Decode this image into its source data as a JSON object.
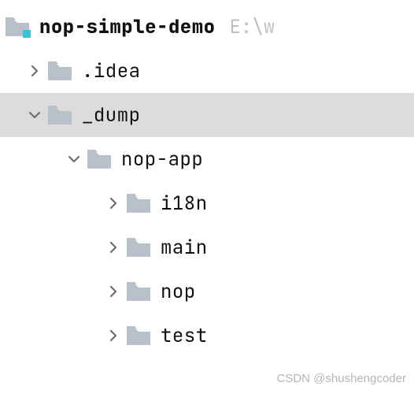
{
  "tree": {
    "root": {
      "label": "nop-simple-demo",
      "hint": "E:\\w",
      "expanded": true,
      "has_badge": true
    },
    "items": [
      {
        "label": ".idea",
        "depth": 1,
        "expanded": false,
        "selected": false
      },
      {
        "label": "_dump",
        "depth": 1,
        "expanded": true,
        "selected": true
      },
      {
        "label": "nop-app",
        "depth": 2,
        "expanded": true,
        "selected": false
      },
      {
        "label": "i18n",
        "depth": 3,
        "expanded": false,
        "selected": false
      },
      {
        "label": "main",
        "depth": 3,
        "expanded": false,
        "selected": false
      },
      {
        "label": "nop",
        "depth": 3,
        "expanded": false,
        "selected": false
      },
      {
        "label": "test",
        "depth": 3,
        "expanded": false,
        "selected": false
      }
    ]
  },
  "colors": {
    "folder_fill": "#b8c0c9",
    "badge_fill": "#3ac2d6",
    "selected_bg": "#dcdcdc"
  },
  "watermark": "CSDN @shushengcoder"
}
